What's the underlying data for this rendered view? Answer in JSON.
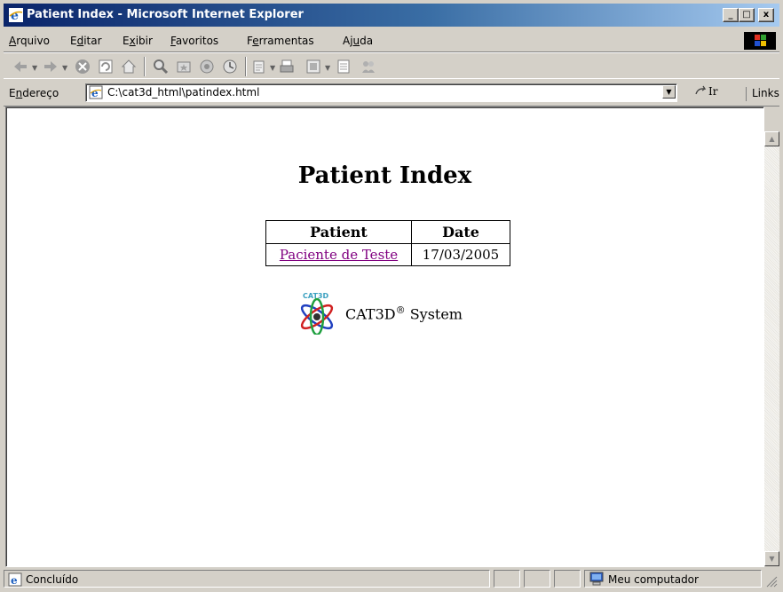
{
  "window": {
    "title": "Patient Index - Microsoft Internet Explorer",
    "minimize_glyph": "_",
    "maximize_glyph": "□",
    "close_glyph": "x"
  },
  "menu": {
    "items": [
      {
        "prefix": "",
        "key": "A",
        "rest": "rquivo"
      },
      {
        "prefix": "E",
        "key": "d",
        "rest": "itar"
      },
      {
        "prefix": "E",
        "key": "x",
        "rest": "ibir"
      },
      {
        "prefix": "",
        "key": "F",
        "rest": "avoritos"
      },
      {
        "prefix": "F",
        "key": "e",
        "rest": "rramentas"
      },
      {
        "prefix": "Aj",
        "key": "u",
        "rest": "da"
      }
    ]
  },
  "address": {
    "label_prefix": "E",
    "label_key": "n",
    "label_rest": "dereço",
    "url": "C:\\cat3d_html\\patindex.html",
    "go_label": "Ir",
    "links_label": "Links"
  },
  "page": {
    "heading": "Patient Index",
    "table": {
      "headers": [
        "Patient",
        "Date"
      ],
      "rows": [
        {
          "patient": "Paciente de Teste",
          "date": "17/03/2005"
        }
      ]
    },
    "brand_text": "CAT3D",
    "brand_mark": "®",
    "brand_suffix": " System",
    "logo_text": "CAT3D"
  },
  "status": {
    "text": "Concluído",
    "zone": "Meu computador"
  },
  "colors": {
    "title_gradient_start": "#0a246a",
    "title_gradient_end": "#a6caf0",
    "visited_link": "#800080",
    "chrome": "#d4d0c8"
  }
}
